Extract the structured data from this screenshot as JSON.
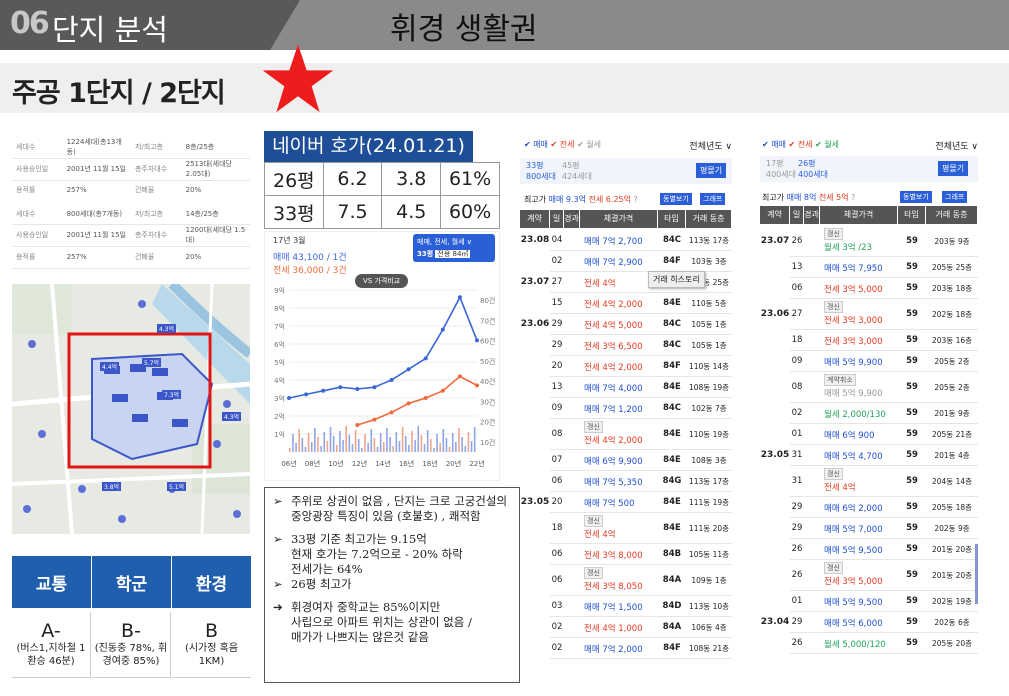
{
  "header": {
    "num": "06",
    "section": "단지 분석",
    "title": "휘경 생활권"
  },
  "subheader": {
    "title": "주공 1단지 / 2단지"
  },
  "info": {
    "rows": [
      [
        "세대수",
        "1224세대(총13개동)",
        "저/최고층",
        "8층/25층"
      ],
      [
        "사용승인일",
        "2001년 11월 15일",
        "총주차대수",
        "2513대(세대당 2.05대)"
      ],
      [
        "용적률",
        "257%",
        "건폐율",
        "20%"
      ],
      [
        "세대수",
        "800세대(총7개동)",
        "저/최고층",
        "14층/25층"
      ],
      [
        "사용승인일",
        "2001년 11월 15일",
        "총주차대수",
        "1200대(세대당 1.5대)"
      ],
      [
        "용적률",
        "257%",
        "건폐율",
        "20%"
      ]
    ]
  },
  "grade": {
    "heads": [
      "교통",
      "학군",
      "환경"
    ],
    "grades": [
      "A-",
      "B-",
      "B"
    ],
    "notes": [
      "(버스1,지하철 1환승 46분)",
      "(진동중 78%, 휘경여중 85%)",
      "(시가정 혹음 1KM)"
    ]
  },
  "naver": {
    "title": "네이버 호가(24.01.21)",
    "rows": [
      [
        "26평",
        "6.2",
        "3.8",
        "61%"
      ],
      [
        "33평",
        "7.5",
        "4.5",
        "60%"
      ]
    ]
  },
  "naver_chart": {
    "date": "17년 3월",
    "sell": "매매 43,100 / 1건",
    "rent": "전세 36,000 / 3건",
    "button_line1": "매매, 전세, 월세 ∨",
    "button_line2": "33평",
    "button_line2b": "전용 84㎡",
    "compare": "VS 가격비교"
  },
  "chart_data": {
    "type": "line",
    "x": [
      "06년",
      "08년",
      "10년",
      "12년",
      "14년",
      "16년",
      "18년",
      "20년",
      "22년"
    ],
    "ylabel_left": [
      "9억",
      "8억",
      "7억",
      "6억",
      "5억",
      "4억",
      "3억",
      "2억",
      "1억"
    ],
    "ylabel_right": [
      "80건",
      "70건",
      "60건",
      "50건",
      "40건",
      "30건",
      "20건",
      "10건"
    ],
    "ylim": [
      0,
      9
    ],
    "series": [
      {
        "name": "매매",
        "color": "#3a66d8",
        "values": [
          3.0,
          3.2,
          3.4,
          3.6,
          3.5,
          3.6,
          4.0,
          4.6,
          5.2,
          6.8,
          8.6,
          6.2
        ]
      },
      {
        "name": "전세",
        "color": "#ef6a3a",
        "values": [
          null,
          null,
          null,
          null,
          1.5,
          1.8,
          2.2,
          2.7,
          3.0,
          3.4,
          4.2,
          3.7
        ]
      }
    ]
  },
  "memo": {
    "b1": "주위로 상권이 없음 , 단지는 크로 고궁건설의 중앙광장 특징이 있음 (호불호) , 쾌적함",
    "b2a": "33평 기준 최고가는 9.15억",
    "b2b": "현재 호가는 7.2억으로 - 20% 하락",
    "b2c": "전세가는 64%",
    "b3": "26평 최고가",
    "b4a": "휘경여자 중학교는 85%이지만",
    "b4b": "사립으로 아파트 위치는 상관이 없음 /",
    "b4c": "매가가 나쁘지는 않은것 같음"
  },
  "left_list": {
    "tabs": [
      "매매",
      "전세",
      "월세"
    ],
    "year": "전체년도 ∨",
    "size1": "33평",
    "size1b": "800세대",
    "size2": "45평",
    "size2b": "424세대",
    "btn": "평몰기",
    "top": "최고가",
    "top_sell": "매매 9.3억",
    "top_rent": "전세 6.25억",
    "btn2": "동별보기",
    "btn3": "그래프",
    "cols": [
      "계약",
      "일",
      "경과",
      "체결가격",
      "타입",
      "거래 동층"
    ],
    "tooltip": "거래 히스토리",
    "rows": [
      {
        "ym": "23.08",
        "d": "04",
        "kind": "sell",
        "price": "매매 7억 2,700",
        "type": "84C",
        "fl": "113동 17층"
      },
      {
        "ym": "",
        "d": "02",
        "kind": "sell",
        "price": "매매 7억 2,900",
        "type": "84F",
        "fl": "103동 3층"
      },
      {
        "ym": "23.07",
        "d": "27",
        "kind": "rent",
        "price": "전세 4억",
        "type": "84D",
        "fl": "113동 25층"
      },
      {
        "ym": "",
        "d": "15",
        "kind": "rent",
        "price": "전세 4억 2,000",
        "type": "84E",
        "fl": "110동 5층"
      },
      {
        "ym": "23.06",
        "d": "29",
        "kind": "rent",
        "price": "전세 4억 5,000",
        "type": "84C",
        "fl": "105동 1층"
      },
      {
        "ym": "",
        "d": "29",
        "kind": "rent",
        "price": "전세 3억 6,500",
        "type": "84C",
        "fl": "105동 1층"
      },
      {
        "ym": "",
        "d": "20",
        "kind": "rent",
        "price": "전세 4억 2,000",
        "type": "84F",
        "fl": "110동 14층"
      },
      {
        "ym": "",
        "d": "13",
        "kind": "sell",
        "price": "매매 7억 4,000",
        "type": "84E",
        "fl": "108동 19층"
      },
      {
        "ym": "",
        "d": "09",
        "kind": "sell",
        "price": "매매 7억 1,200",
        "type": "84C",
        "fl": "102동 7층"
      },
      {
        "ym": "",
        "d": "08",
        "kind": "rent",
        "price": "전세 4억 2,000",
        "type": "84E",
        "fl": "110동 19층",
        "badge": "갱신"
      },
      {
        "ym": "",
        "d": "07",
        "kind": "sell",
        "price": "매매 6억 9,900",
        "type": "84E",
        "fl": "108동 3층"
      },
      {
        "ym": "",
        "d": "06",
        "kind": "sell",
        "price": "매매 7억 5,350",
        "type": "84G",
        "fl": "113동 17층"
      },
      {
        "ym": "23.05",
        "d": "20",
        "kind": "sell",
        "price": "매매 7억 500",
        "type": "84E",
        "fl": "111동 19층"
      },
      {
        "ym": "",
        "d": "18",
        "kind": "rent",
        "price": "전세 4억",
        "type": "84E",
        "fl": "111동 20층",
        "badge": "갱신"
      },
      {
        "ym": "",
        "d": "06",
        "kind": "rent",
        "price": "전세 3억 8,000",
        "type": "84B",
        "fl": "105동 11층"
      },
      {
        "ym": "",
        "d": "06",
        "kind": "rent",
        "price": "전세 3억 8,050",
        "type": "84A",
        "fl": "109동 1층",
        "badge": "갱신"
      },
      {
        "ym": "",
        "d": "03",
        "kind": "sell",
        "price": "매매 7억 1,500",
        "type": "84D",
        "fl": "113동 10층"
      },
      {
        "ym": "",
        "d": "02",
        "kind": "rent",
        "price": "전세 4억 1,000",
        "type": "84A",
        "fl": "106동 4층"
      },
      {
        "ym": "",
        "d": "02",
        "kind": "sell",
        "price": "매매 7억 2,000",
        "type": "84F",
        "fl": "108동 21층"
      }
    ]
  },
  "right_list": {
    "tabs": [
      "매매",
      "전세",
      "월세"
    ],
    "year": "전체년도 ∨",
    "size1": "17평",
    "size1b": "400세대",
    "size2": "26평",
    "size2b": "400세대",
    "btn": "평몰기",
    "top": "최고가",
    "top_sell": "매매 8억",
    "top_rent": "전세 5억",
    "btn2": "동별보기",
    "btn3": "그래프",
    "cols": [
      "계약",
      "일",
      "경과",
      "체결가격",
      "타입",
      "거래 동층"
    ],
    "rows": [
      {
        "ym": "23.07",
        "d": "26",
        "kind": "wol",
        "price": "월세 3억 /23",
        "type": "59",
        "fl": "203동 9층",
        "badge": "갱신"
      },
      {
        "ym": "",
        "d": "13",
        "kind": "sell",
        "price": "매매 5억 7,950",
        "type": "59",
        "fl": "205동 25층"
      },
      {
        "ym": "",
        "d": "06",
        "kind": "rent",
        "price": "전세 3억 5,000",
        "type": "59",
        "fl": "203동 18층"
      },
      {
        "ym": "23.06",
        "d": "27",
        "kind": "rent",
        "price": "전세 3억 3,000",
        "type": "59",
        "fl": "202동 18층",
        "badge": "갱신"
      },
      {
        "ym": "",
        "d": "18",
        "kind": "rent",
        "price": "전세 3억 3,000",
        "type": "59",
        "fl": "203동 16층"
      },
      {
        "ym": "",
        "d": "09",
        "kind": "sell",
        "price": "매매 5억 9,900",
        "type": "59",
        "fl": "205동 2층"
      },
      {
        "ym": "",
        "d": "08",
        "kind": "gray",
        "price": "매매 5억 9,900",
        "type": "59",
        "fl": "205동 2층",
        "badge": "계약취소"
      },
      {
        "ym": "",
        "d": "02",
        "kind": "wol",
        "price": "월세 2,000/130",
        "type": "59",
        "fl": "201동 9층"
      },
      {
        "ym": "",
        "d": "01",
        "kind": "sell",
        "price": "매매 6억 900",
        "type": "59",
        "fl": "205동 21층"
      },
      {
        "ym": "23.05",
        "d": "31",
        "kind": "sell",
        "price": "매매 5억 4,700",
        "type": "59",
        "fl": "201동 4층"
      },
      {
        "ym": "",
        "d": "31",
        "kind": "rent",
        "price": "전세 4억",
        "type": "59",
        "fl": "204동 14층",
        "badge": "갱신"
      },
      {
        "ym": "",
        "d": "29",
        "kind": "sell",
        "price": "매매 6억 2,000",
        "type": "59",
        "fl": "205동 18층"
      },
      {
        "ym": "",
        "d": "29",
        "kind": "sell",
        "price": "매매 5억 7,000",
        "type": "59",
        "fl": "202동 9층"
      },
      {
        "ym": "",
        "d": "26",
        "kind": "sell",
        "price": "매매 5억 9,500",
        "type": "59",
        "fl": "201동 20층"
      },
      {
        "ym": "",
        "d": "26",
        "kind": "rent",
        "price": "전세 3억 5,000",
        "type": "59",
        "fl": "201동 20층",
        "badge": "갱신"
      },
      {
        "ym": "",
        "d": "01",
        "kind": "sell",
        "price": "매매 5억 9,500",
        "type": "59",
        "fl": "202동 19층"
      },
      {
        "ym": "23.04",
        "d": "29",
        "kind": "sell",
        "price": "매매 5억 6,000",
        "type": "59",
        "fl": "202동 6층"
      },
      {
        "ym": "",
        "d": "26",
        "kind": "wol",
        "price": "월세 5,000/120",
        "type": "59",
        "fl": "205동 20층"
      }
    ]
  },
  "map_labels": {
    "l1": "4.4억",
    "l2": "5.7억",
    "l3": "4.3억",
    "l4": "4.3억",
    "l5": "7.3억",
    "l6": "3.8억",
    "l7": "5.1억"
  }
}
